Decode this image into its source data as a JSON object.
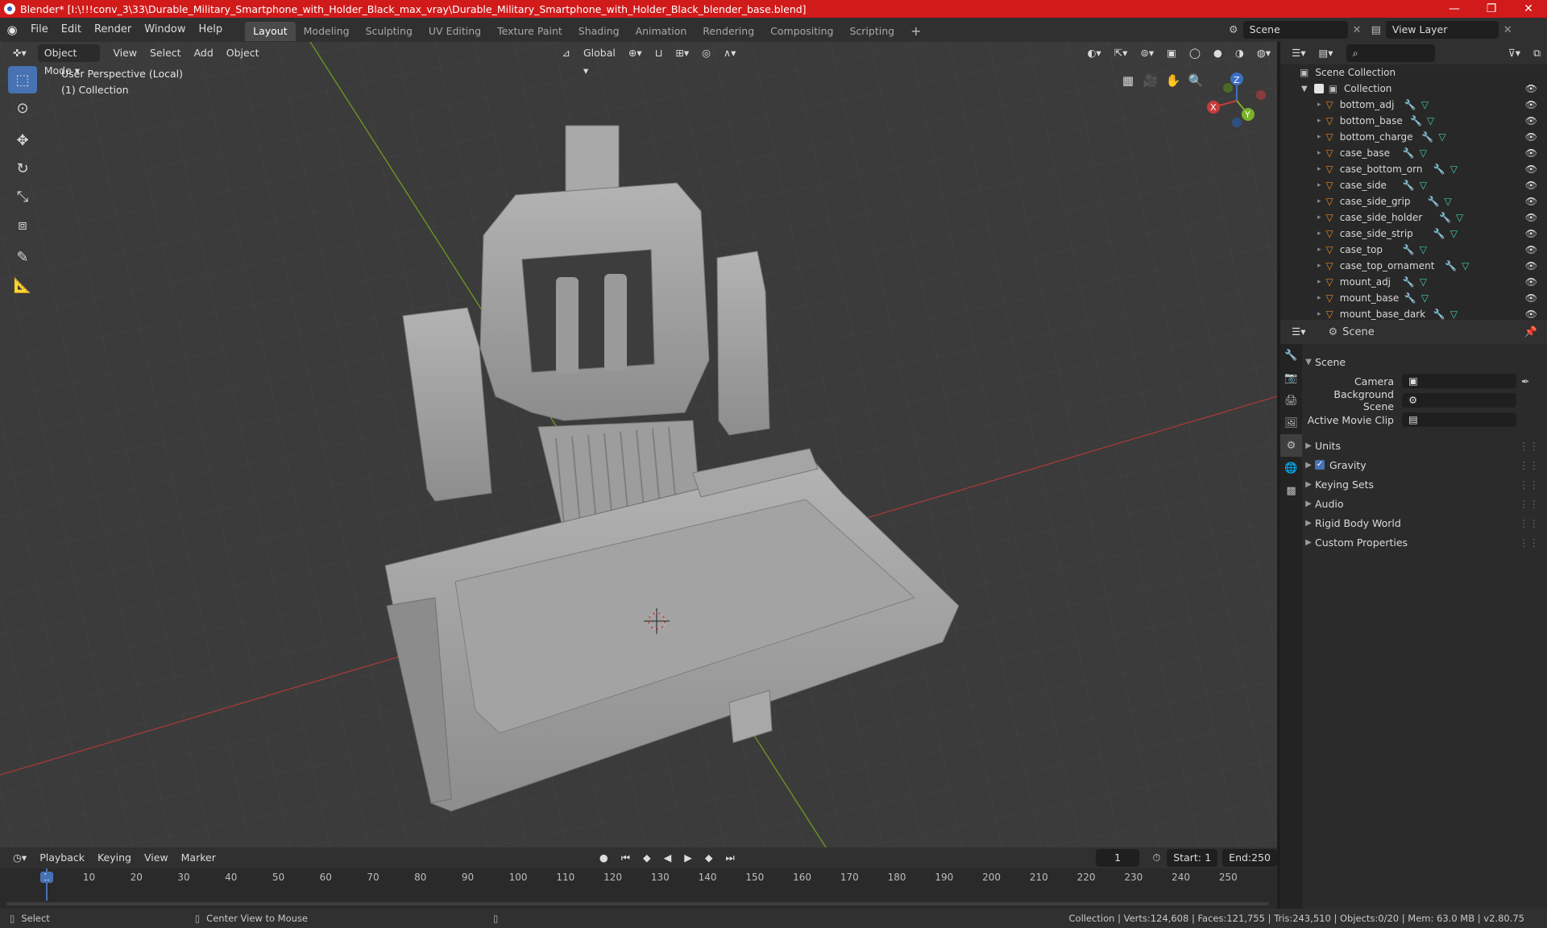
{
  "window": {
    "title": "Blender* [I:\\!!!conv_3\\33\\Durable_Military_Smartphone_with_Holder_Black_max_vray\\Durable_Military_Smartphone_with_Holder_Black_blender_base.blend]",
    "minimize": "—",
    "maximize": "❐",
    "close": "✕"
  },
  "menu": {
    "items": [
      "File",
      "Edit",
      "Render",
      "Window",
      "Help"
    ],
    "workspaces": [
      "Layout",
      "Modeling",
      "Sculpting",
      "UV Editing",
      "Texture Paint",
      "Shading",
      "Animation",
      "Rendering",
      "Compositing",
      "Scripting"
    ],
    "active_workspace": "Layout",
    "add_tab": "+",
    "scene": "Scene",
    "view_layer": "View Layer"
  },
  "viewport": {
    "mode": "Object Mode",
    "menus": [
      "View",
      "Select",
      "Add",
      "Object"
    ],
    "orientation": "Global",
    "perspective_label": "User Perspective (Local)",
    "collection_label": "(1) Collection",
    "axis_x": "X",
    "axis_y": "Y",
    "axis_z": "Z",
    "colors": {
      "background": "#3b3b3b",
      "grid": "#434343",
      "x_axis": "#b43a3a",
      "y_axis": "#6f9a1f",
      "model": "#9c9c9c"
    }
  },
  "timeline": {
    "menus": [
      "Playback",
      "Keying",
      "View",
      "Marker"
    ],
    "current_frame": "1",
    "start_label": "Start:",
    "start": "1",
    "end_label": "End:",
    "end": "250",
    "ticks": [
      "1",
      "10",
      "20",
      "30",
      "40",
      "50",
      "60",
      "70",
      "80",
      "90",
      "100",
      "110",
      "120",
      "130",
      "140",
      "150",
      "160",
      "170",
      "180",
      "190",
      "200",
      "210",
      "220",
      "230",
      "240",
      "250"
    ]
  },
  "statusbar": {
    "select": "Select",
    "center_view": "Center View to Mouse",
    "stats": "Collection | Verts:124,608 | Faces:121,755 | Tris:243,510 | Objects:0/20 | Mem: 63.0 MB | v2.80.75"
  },
  "outliner": {
    "scene_collection": "Scene Collection",
    "collection": "Collection",
    "objects": [
      "bottom_adj",
      "bottom_base",
      "bottom_charge",
      "case_base",
      "case_bottom_orn",
      "case_side",
      "case_side_grip",
      "case_side_holder",
      "case_side_strip",
      "case_top",
      "case_top_ornament",
      "mount_adj",
      "mount_base",
      "mount_base_dark"
    ]
  },
  "properties": {
    "header": "Scene",
    "panel_title": "Scene",
    "camera_label": "Camera",
    "background_scene_label": "Background Scene",
    "active_clip_label": "Active Movie Clip",
    "sections": [
      "Units",
      "Gravity",
      "Keying Sets",
      "Audio",
      "Rigid Body World",
      "Custom Properties"
    ],
    "gravity_checked": true
  }
}
